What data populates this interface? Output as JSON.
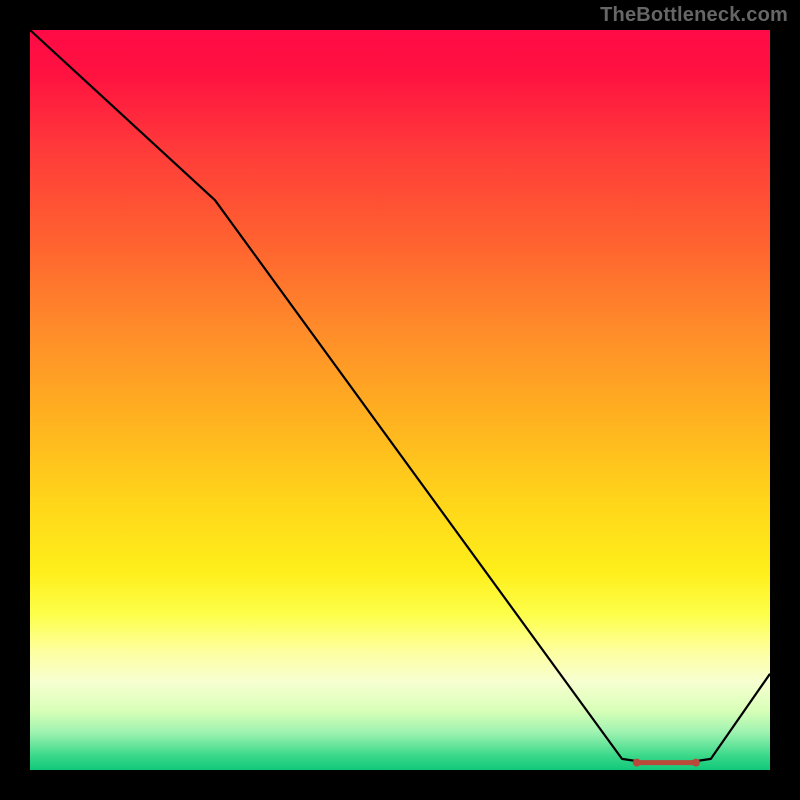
{
  "attribution": "TheBottleneck.com",
  "chart_data": {
    "type": "line",
    "title": "",
    "xlabel": "",
    "ylabel": "",
    "xlim": [
      0,
      100
    ],
    "ylim": [
      0,
      100
    ],
    "x": [
      0,
      25,
      80,
      82,
      84,
      86,
      88,
      90,
      92,
      100
    ],
    "values": [
      100,
      77,
      1.5,
      1.2,
      1.0,
      1.0,
      1.0,
      1.2,
      1.5,
      13
    ],
    "markers": {
      "x": [
        82,
        84,
        86,
        88,
        90
      ],
      "y": [
        1.2,
        1.0,
        1.0,
        1.0,
        1.2
      ],
      "color": "#b94a3a"
    },
    "gradient_stops": [
      {
        "pos": 0.0,
        "color": "#ff0a46"
      },
      {
        "pos": 0.3,
        "color": "#ff6030"
      },
      {
        "pos": 0.6,
        "color": "#ffd61a"
      },
      {
        "pos": 0.8,
        "color": "#fdff6a"
      },
      {
        "pos": 0.92,
        "color": "#d8ffb8"
      },
      {
        "pos": 1.0,
        "color": "#10c87a"
      }
    ]
  }
}
